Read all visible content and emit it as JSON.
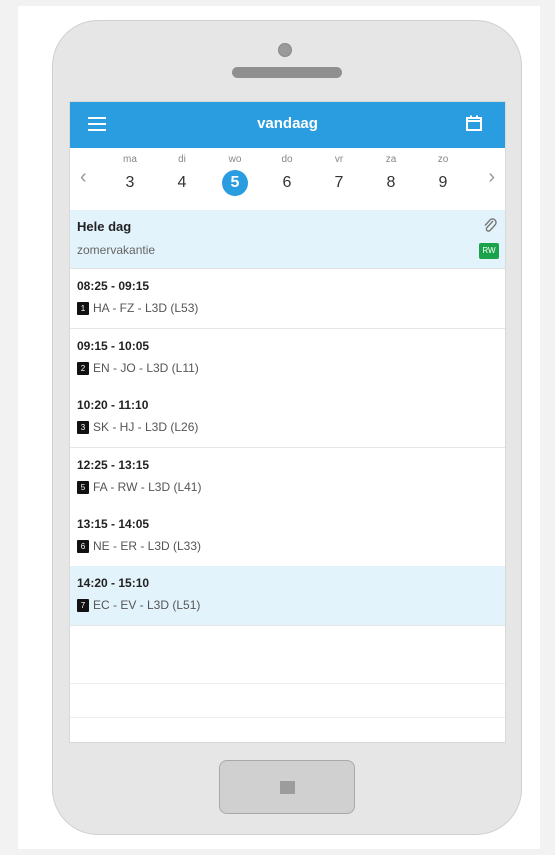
{
  "app": {
    "title": "vandaag",
    "accent_color": "#2a9ce0",
    "menu_icon": "hamburger-icon",
    "calendar_icon": "calendar-icon"
  },
  "week": {
    "prev_icon": "chevron-left-icon",
    "next_icon": "chevron-right-icon",
    "days": [
      {
        "abbr": "ma",
        "num": "3",
        "selected": false
      },
      {
        "abbr": "di",
        "num": "4",
        "selected": false
      },
      {
        "abbr": "wo",
        "num": "5",
        "selected": true
      },
      {
        "abbr": "do",
        "num": "6",
        "selected": false
      },
      {
        "abbr": "vr",
        "num": "7",
        "selected": false
      },
      {
        "abbr": "za",
        "num": "8",
        "selected": false
      },
      {
        "abbr": "zo",
        "num": "9",
        "selected": false
      }
    ]
  },
  "allday": {
    "title": "Hele dag",
    "subtitle": "zomervakantie",
    "badge": "RW",
    "badge_color": "#1aa34a",
    "attachment_icon": "paperclip-icon"
  },
  "lessons": [
    {
      "time": "08:25 - 09:15",
      "hour": "1",
      "info": "HA - FZ - L3D (L53)"
    },
    {
      "time": "09:15 - 10:05",
      "hour": "2",
      "info": "EN - JO - L3D (L11)"
    },
    {
      "time": "10:20 - 11:10",
      "hour": "3",
      "info": "SK - HJ - L3D (L26)"
    },
    {
      "time": "12:25 - 13:15",
      "hour": "5",
      "info": "FA - RW - L3D (L41)"
    },
    {
      "time": "13:15 - 14:05",
      "hour": "6",
      "info": "NE - ER - L3D (L33)"
    },
    {
      "time": "14:20 - 15:10",
      "hour": "7",
      "info": "EC - EV - L3D (L51)",
      "highlight": true
    }
  ]
}
